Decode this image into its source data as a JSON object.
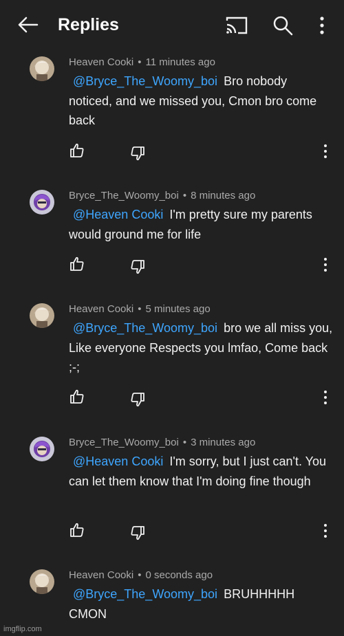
{
  "header": {
    "title": "Replies",
    "icons": [
      "back-arrow-icon",
      "cast-icon",
      "search-icon",
      "more-vert-icon"
    ]
  },
  "comments": [
    {
      "author": "Heaven Cooki",
      "time": "11 minutes ago",
      "mention": "@Bryce_The_Woomy_boi",
      "text": "Bro nobody noticed, and we missed you, Cmon bro come back",
      "avatar": "white-hair"
    },
    {
      "author": "Bryce_The_Woomy_boi",
      "time": "8 minutes ago",
      "mention": "@Heaven Cooki",
      "text": "I'm pretty sure my parents would ground me for life",
      "avatar": "purple-hair"
    },
    {
      "author": "Heaven Cooki",
      "time": "5 minutes ago",
      "mention": "@Bryce_The_Woomy_boi",
      "text": "bro we all miss you, Like everyone Respects you lmfao, Come back ;-;",
      "avatar": "white-hair"
    },
    {
      "author": "Bryce_The_Woomy_boi",
      "time": "3 minutes ago",
      "mention": "@Heaven Cooki",
      "text": "I'm sorry, but I just can't. You can let them know that I'm doing fine though",
      "avatar": "purple-hair"
    },
    {
      "author": "Heaven Cooki",
      "time": "0 seconds ago",
      "mention": "@Bryce_The_Woomy_boi",
      "text": "BRUHHHHH CMON",
      "avatar": "white-hair"
    }
  ],
  "watermark": "imgflip.com",
  "colors": {
    "background": "#212121",
    "mention": "#3ea6ff",
    "meta": "#aaaaaa"
  }
}
